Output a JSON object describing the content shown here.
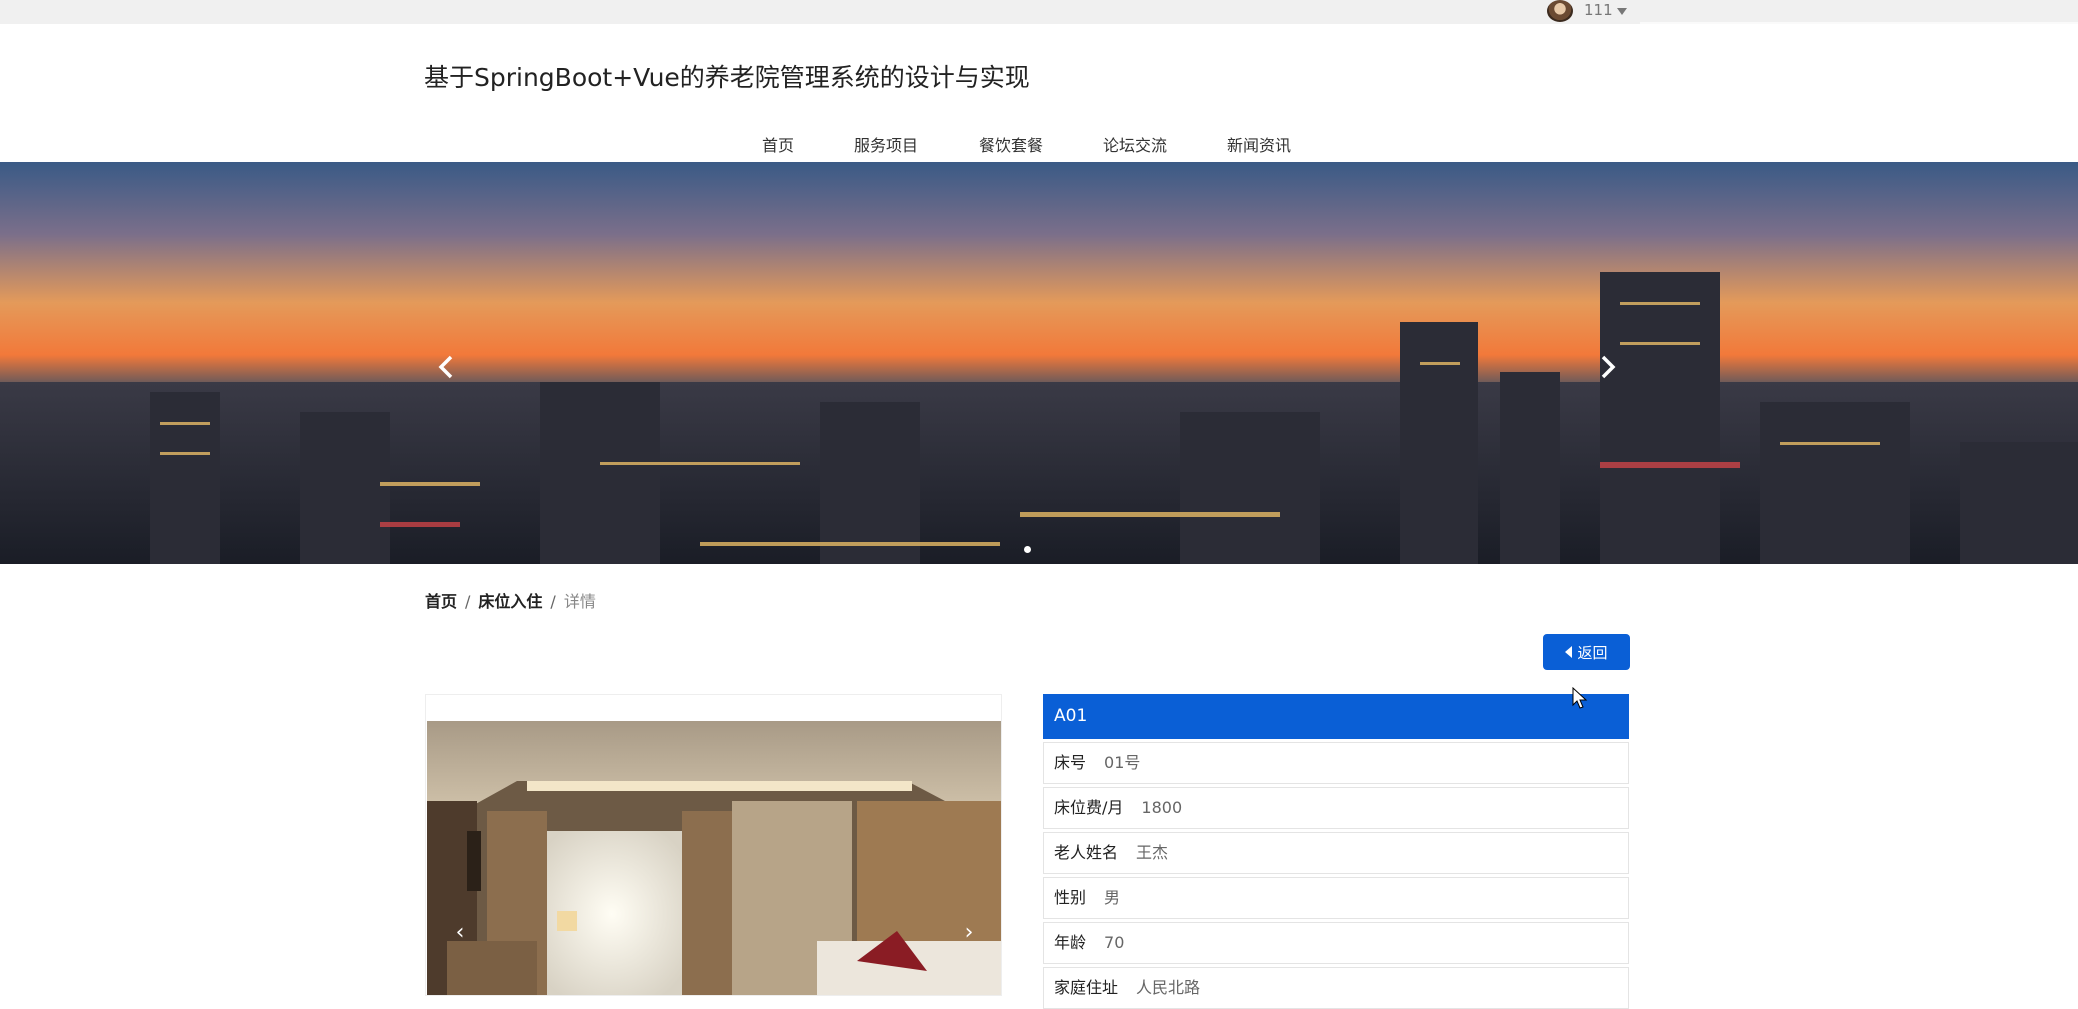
{
  "topbar": {
    "username": "111"
  },
  "header": {
    "title": "基于SpringBoot+Vue的养老院管理系统的设计与实现"
  },
  "nav": {
    "items": [
      {
        "label": "首页"
      },
      {
        "label": "服务项目"
      },
      {
        "label": "餐饮套餐"
      },
      {
        "label": "论坛交流"
      },
      {
        "label": "新闻资讯"
      }
    ]
  },
  "breadcrumb": {
    "home": "首页",
    "section": "床位入住",
    "current": "详情",
    "separator": "/"
  },
  "back_button": {
    "label": "返回"
  },
  "detail": {
    "title": "A01",
    "fields": [
      {
        "label": "床号",
        "value": "01号"
      },
      {
        "label": "床位费/月",
        "value": "1800"
      },
      {
        "label": "老人姓名",
        "value": "王杰"
      },
      {
        "label": "性别",
        "value": "男"
      },
      {
        "label": "年龄",
        "value": "70"
      },
      {
        "label": "家庭住址",
        "value": "人民北路"
      }
    ]
  },
  "colors": {
    "primary": "#0a5fd6",
    "topbar": "#f0f0f0"
  },
  "icons": [
    "avatar",
    "caret-down-icon",
    "chevron-left-icon",
    "chevron-right-icon",
    "back-triangle-icon"
  ]
}
